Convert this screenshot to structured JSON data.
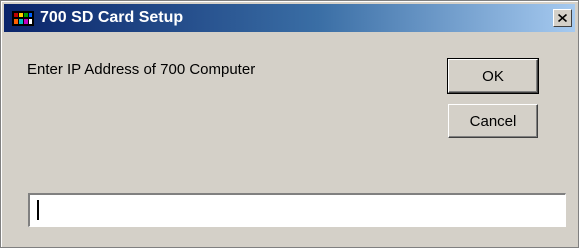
{
  "window": {
    "title": "700 SD Card Setup",
    "icon": "application-icon",
    "close_icon": "close-icon",
    "close_label": "×"
  },
  "dialog": {
    "prompt": "Enter IP Address of 700 Computer",
    "ok_label": "OK",
    "cancel_label": "Cancel",
    "ip_value": ""
  }
}
